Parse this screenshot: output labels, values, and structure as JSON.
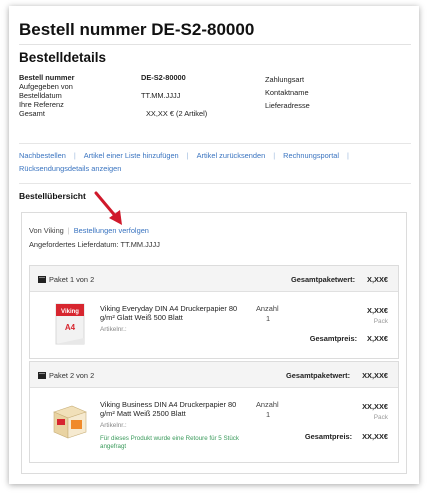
{
  "page": {
    "title": "Bestell nummer DE-S2-80000",
    "subtitle": "Bestelldetails"
  },
  "details": {
    "rows": [
      {
        "label": "Bestell nummer",
        "value": "DE-S2-80000"
      },
      {
        "label": "Aufgegeben von",
        "value": ""
      },
      {
        "label": "Bestelldatum",
        "value": "TT.MM.JJJJ"
      },
      {
        "label": "Ihre Referenz",
        "value": ""
      },
      {
        "label": "Gesamt",
        "value": "XX,XX € (2 Artikel)"
      }
    ],
    "right_labels": [
      "Zahlungsart",
      "Kontaktname",
      "Lieferadresse"
    ]
  },
  "links": [
    "Nachbestellen",
    "Artikel einer Liste hinzufügen",
    "Artikel zurücksenden",
    "Rechnungsportal",
    "Rücksendungsdetails anzeigen"
  ],
  "overview": {
    "title": "Bestellübersicht",
    "vendor": "Von Viking",
    "track_link": "Bestellungen verfolgen",
    "delivery_label": "Angefordertes Lieferdatum:",
    "delivery_value": "TT.MM.JJJJ"
  },
  "packages": [
    {
      "label": "Paket 1 von 2",
      "value_label": "Gesamtpaketwert:",
      "value": "X,XX€",
      "product": "Viking Everyday DIN A4 Druckerpapier 80 g/m² Glatt Weiß 500 Blatt",
      "article": "Artikelnr.:",
      "qty_label": "Anzahl",
      "qty": "1",
      "price": "X,XX€",
      "unit": "Pack",
      "total_label": "Gesamtpreis:",
      "total": "X,XX€",
      "note": ""
    },
    {
      "label": "Paket 2 von 2",
      "value_label": "Gesamtpaketwert:",
      "value": "XX,XX€",
      "product": "Viking Business DIN A4 Druckerpapier 80 g/m² Matt Weiß 2500 Blatt",
      "article": "Artikelnr.:",
      "qty_label": "Anzahl",
      "qty": "1",
      "price": "XX,XX€",
      "unit": "Pack",
      "total_label": "Gesamtpreis:",
      "total": "XX,XX€",
      "note": "Für dieses Produkt wurde eine Retoure für 5 Stück angefragt"
    }
  ],
  "icons": {
    "package": "package-box-icon",
    "annotation": "red-arrow-icon"
  },
  "colors": {
    "link": "#3a74c0",
    "note": "#3a9a5b",
    "arrow": "#d0192b"
  }
}
